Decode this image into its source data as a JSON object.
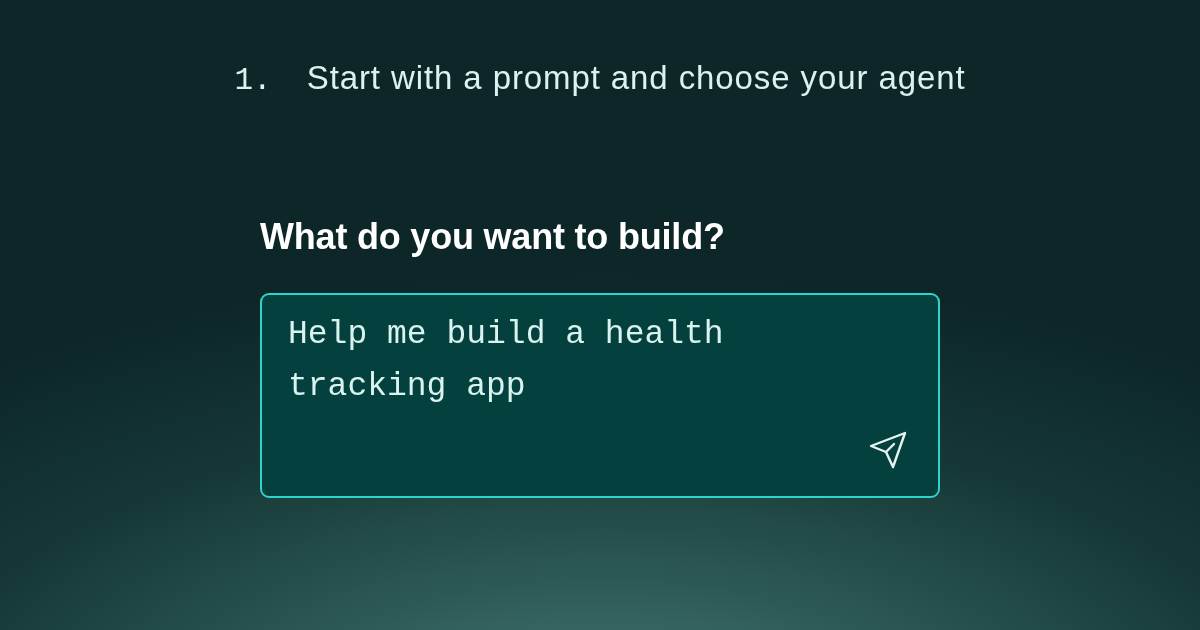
{
  "step": {
    "number": "1.",
    "text": "Start with a prompt and choose your agent"
  },
  "heading": "What do you want to build?",
  "prompt": {
    "value": "Help me build a health tracking app"
  }
}
